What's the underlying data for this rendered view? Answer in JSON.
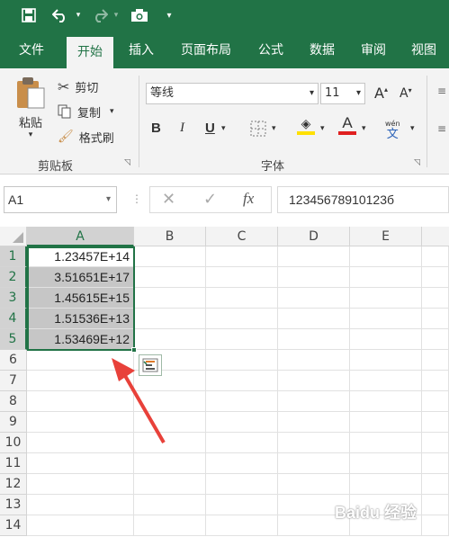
{
  "qat": {
    "icons": [
      "save-icon",
      "undo-icon",
      "redo-icon",
      "camera-icon",
      "customize-icon"
    ]
  },
  "tabs": [
    "文件",
    "开始",
    "插入",
    "页面布局",
    "公式",
    "数据",
    "审阅",
    "视图"
  ],
  "clipboard": {
    "paste": "粘贴",
    "cut": "剪切",
    "copy": "复制",
    "format_painter": "格式刷",
    "label": "剪贴板"
  },
  "font": {
    "name": "等线",
    "size": "11",
    "label": "字体",
    "bold": "B",
    "italic": "I",
    "underline": "U",
    "grow": "A",
    "shrink": "A",
    "font_color_letter": "A",
    "phonetic_top": "wén",
    "phonetic_bottom": "文",
    "accent_color": "#e02020",
    "fill_color": "#ffe000"
  },
  "formula_bar": {
    "name_box": "A1",
    "fx": "fx",
    "value": "12345678910123б"
  },
  "sheet": {
    "columns": [
      "A",
      "B",
      "C",
      "D",
      "E"
    ],
    "rows": [
      "1",
      "2",
      "3",
      "4",
      "5",
      "6",
      "7",
      "8",
      "9",
      "10",
      "11",
      "12",
      "13",
      "14"
    ],
    "cells_A": [
      "1.23457E+14",
      "3.51651E+17",
      "1.45615E+15",
      "1.51536E+13",
      "1.53469E+12"
    ]
  },
  "watermark": "Baidu 经验",
  "colors": {
    "excel_green": "#217346",
    "arrow": "#e8413a"
  }
}
